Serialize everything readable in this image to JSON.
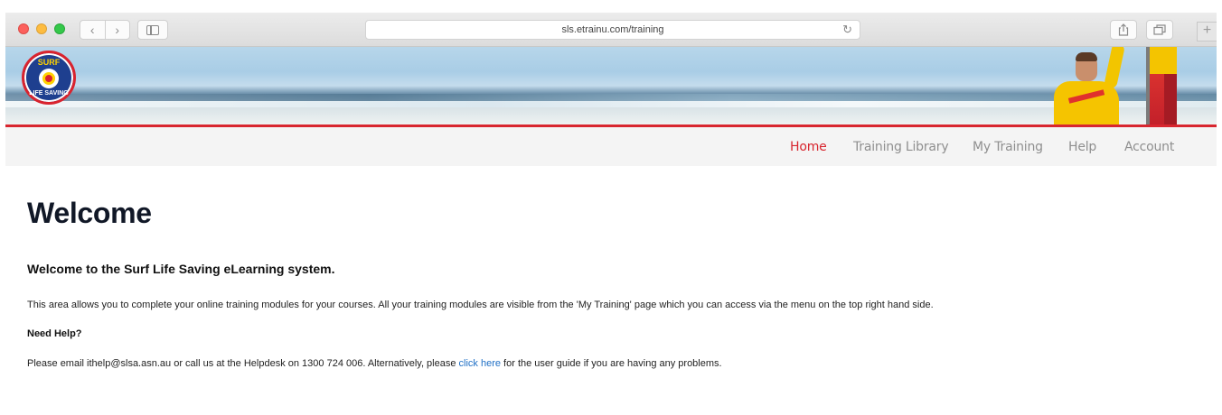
{
  "browser": {
    "url": "sls.etrainu.com/training",
    "back_glyph": "‹",
    "forward_glyph": "›",
    "reload_glyph": "↻",
    "new_tab_glyph": "+"
  },
  "header": {
    "logo": {
      "top_text": "SURF",
      "bottom_text": "LIFE SAVING"
    }
  },
  "nav": {
    "items": [
      {
        "label": "Home",
        "active": true
      },
      {
        "label": "Training Library",
        "active": false
      },
      {
        "label": "My Training",
        "active": false
      },
      {
        "label": "Help",
        "active": false
      },
      {
        "label": "Account",
        "active": false
      }
    ]
  },
  "main": {
    "title": "Welcome",
    "subtitle": "Welcome to the Surf Life Saving eLearning system.",
    "paragraph1": "This area allows you to complete your online training modules for your courses. All your training modules are visible from the 'My Training' page which you can access via the menu on the top right hand side.",
    "help_heading": "Need Help?",
    "paragraph2_before": "Please email ithelp@slsa.asn.au or call us at the Helpdesk on 1300 724 006. Alternatively, please ",
    "paragraph2_link": "click here",
    "paragraph2_after": " for the user guide if you are having any problems."
  },
  "colors": {
    "accent_red": "#d8262f",
    "link_blue": "#1f6fc5",
    "nav_gray": "#8f8f8f"
  }
}
